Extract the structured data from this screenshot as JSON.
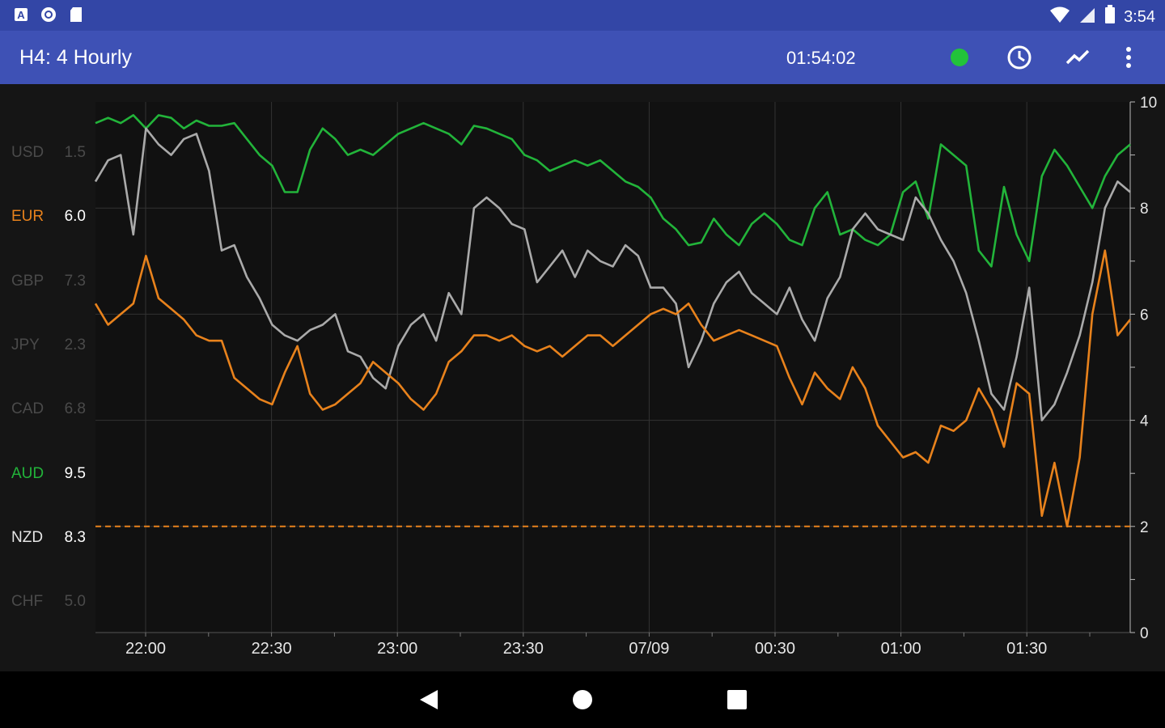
{
  "status_bar": {
    "time": "3:54",
    "left_icons": [
      "app-a-icon",
      "circle-target-icon",
      "sd-card-icon"
    ],
    "right_icons": [
      "wifi-icon",
      "signal-icon",
      "battery-icon"
    ]
  },
  "app_bar": {
    "title": "H4: 4 Hourly",
    "timer": "01:54:02",
    "status_color": "#22c33a",
    "actions": [
      "clock-icon",
      "trend-line-icon",
      "more-vert-icon"
    ]
  },
  "colors": {
    "status_bar_bg": "#3346a6",
    "app_bar_bg": "#3e51b5",
    "chart_bg": "#151515",
    "usd": "#aaaaaa",
    "eur": "#e8821c",
    "aud": "#22b43a",
    "nzd": "#e8821c"
  },
  "currencies": [
    {
      "code": "USD",
      "value": "1.5",
      "state": "dim"
    },
    {
      "code": "EUR",
      "value": "6.0",
      "state": "eur"
    },
    {
      "code": "GBP",
      "value": "7.3",
      "state": "dim"
    },
    {
      "code": "JPY",
      "value": "2.3",
      "state": "dim"
    },
    {
      "code": "CAD",
      "value": "6.8",
      "state": "dim"
    },
    {
      "code": "AUD",
      "value": "9.5",
      "state": "aud"
    },
    {
      "code": "NZD",
      "value": "8.3",
      "state": "nzd"
    },
    {
      "code": "CHF",
      "value": "5.0",
      "state": "dim"
    }
  ],
  "chart_data": {
    "type": "line",
    "x_tick_labels": [
      "22:00",
      "22:30",
      "23:00",
      "23:30",
      "07/09",
      "00:30",
      "01:00",
      "01:30"
    ],
    "y_tick_labels": [
      "0",
      "2",
      "4",
      "6",
      "8",
      "10"
    ],
    "ylim": [
      0,
      10
    ],
    "grid": true,
    "x": [
      0,
      0.1,
      0.2,
      0.3,
      0.4,
      0.5,
      0.6,
      0.7,
      0.8,
      0.9,
      1.0,
      1.1,
      1.2,
      1.3,
      1.4,
      1.5,
      1.6,
      1.7,
      1.8,
      1.9,
      2.0,
      2.1,
      2.2,
      2.3,
      2.4,
      2.5,
      2.6,
      2.7,
      2.8,
      2.9,
      3.0,
      3.1,
      3.2,
      3.3,
      3.4,
      3.5,
      3.6,
      3.7,
      3.8,
      3.9,
      4.0,
      4.1,
      4.2,
      4.3,
      4.4,
      4.5,
      4.6,
      4.7,
      4.8,
      4.9,
      5.0,
      5.1,
      5.2,
      5.3,
      5.4,
      5.5,
      5.6,
      5.7,
      5.8,
      5.9,
      6.0,
      6.1,
      6.2,
      6.3,
      6.4,
      6.5,
      6.6,
      6.7,
      6.8,
      6.9,
      7.0,
      7.1,
      7.2,
      7.3,
      7.4,
      7.5,
      7.6,
      7.7,
      7.8,
      7.9,
      8.0,
      8.1,
      8.2
    ],
    "series": [
      {
        "key": "aud",
        "color": "#22b43a",
        "values": [
          9.6,
          9.7,
          9.6,
          9.75,
          9.5,
          9.75,
          9.7,
          9.5,
          9.65,
          9.55,
          9.55,
          9.6,
          9.3,
          9.0,
          8.8,
          8.3,
          8.3,
          9.1,
          9.5,
          9.3,
          9.0,
          9.1,
          9.0,
          9.2,
          9.4,
          9.5,
          9.6,
          9.5,
          9.4,
          9.2,
          9.55,
          9.5,
          9.4,
          9.3,
          9.0,
          8.9,
          8.7,
          8.8,
          8.9,
          8.8,
          8.9,
          8.7,
          8.5,
          8.4,
          8.2,
          7.8,
          7.6,
          7.3,
          7.35,
          7.8,
          7.5,
          7.3,
          7.7,
          7.9,
          7.7,
          7.4,
          7.3,
          8.0,
          8.3,
          7.5,
          7.6,
          7.4,
          7.3,
          7.5,
          8.3,
          8.5,
          7.8,
          9.2,
          9.0,
          8.8,
          7.2,
          6.9,
          8.4,
          7.5,
          7.0,
          8.6,
          9.1,
          8.8,
          8.4,
          8.0,
          8.6,
          9.0,
          9.2
        ]
      },
      {
        "key": "usd",
        "color": "#aaaaaa",
        "values": [
          8.5,
          8.9,
          9.0,
          7.5,
          9.5,
          9.2,
          9.0,
          9.3,
          9.4,
          8.7,
          7.2,
          7.3,
          6.7,
          6.3,
          5.8,
          5.6,
          5.5,
          5.7,
          5.8,
          6.0,
          5.3,
          5.2,
          4.8,
          4.6,
          5.4,
          5.8,
          6.0,
          5.5,
          6.4,
          6.0,
          8.0,
          8.2,
          8.0,
          7.7,
          7.6,
          6.6,
          6.9,
          7.2,
          6.7,
          7.2,
          7.0,
          6.9,
          7.3,
          7.1,
          6.5,
          6.5,
          6.2,
          5.0,
          5.5,
          6.2,
          6.6,
          6.8,
          6.4,
          6.2,
          6.0,
          6.5,
          5.9,
          5.5,
          6.3,
          6.7,
          7.6,
          7.9,
          7.6,
          7.5,
          7.4,
          8.2,
          7.9,
          7.4,
          7.0,
          6.4,
          5.5,
          4.5,
          4.2,
          5.2,
          6.5,
          4.0,
          4.3,
          4.9,
          5.6,
          6.6,
          8.0,
          8.5,
          8.3
        ]
      },
      {
        "key": "eur",
        "color": "#e8821c",
        "values": [
          6.2,
          5.8,
          6.0,
          6.2,
          7.1,
          6.3,
          6.1,
          5.9,
          5.6,
          5.5,
          5.5,
          4.8,
          4.6,
          4.4,
          4.3,
          4.9,
          5.4,
          4.5,
          4.2,
          4.3,
          4.5,
          4.7,
          5.1,
          4.9,
          4.7,
          4.4,
          4.2,
          4.5,
          5.1,
          5.3,
          5.6,
          5.6,
          5.5,
          5.6,
          5.4,
          5.3,
          5.4,
          5.2,
          5.4,
          5.6,
          5.6,
          5.4,
          5.6,
          5.8,
          6.0,
          6.1,
          6.0,
          6.2,
          5.8,
          5.5,
          5.6,
          5.7,
          5.6,
          5.5,
          5.4,
          4.8,
          4.3,
          4.9,
          4.6,
          4.4,
          5.0,
          4.6,
          3.9,
          3.6,
          3.3,
          3.4,
          3.2,
          3.9,
          3.8,
          4.0,
          4.6,
          4.2,
          3.5,
          4.7,
          4.5,
          2.2,
          3.2,
          2.0,
          3.3,
          6.0,
          7.2,
          5.6,
          5.9
        ]
      }
    ],
    "reference_line": {
      "y": 2.0,
      "color": "#e8821c",
      "style": "dashed"
    }
  },
  "nav_bar": {
    "buttons": [
      "back-icon",
      "home-icon",
      "recents-icon"
    ]
  }
}
